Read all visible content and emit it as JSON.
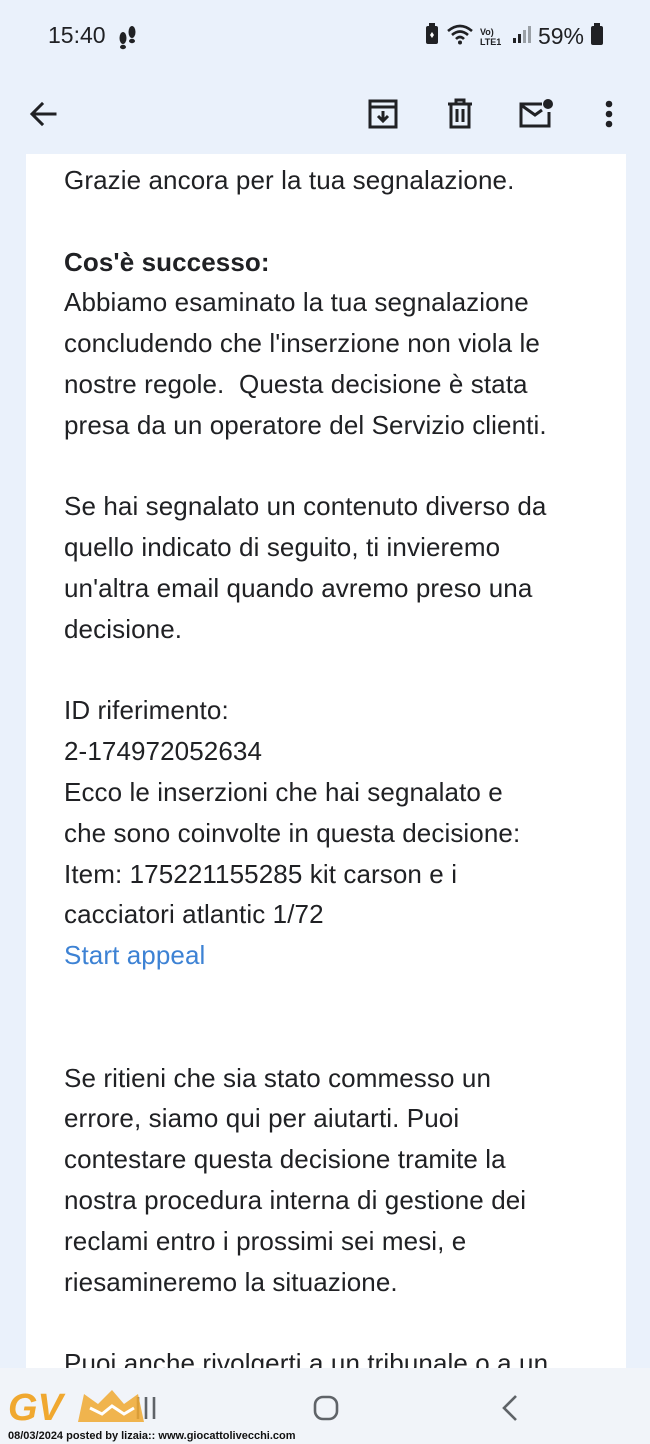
{
  "status_bar": {
    "time": "15:40",
    "network_label": "Vo) LTE1",
    "battery": "59%",
    "icons": [
      "footsteps-icon",
      "battery-saver-icon",
      "wifi-icon",
      "volte-icon",
      "signal-icon",
      "battery-icon"
    ]
  },
  "toolbar": {
    "icons": [
      "back-arrow-icon",
      "archive-icon",
      "delete-icon",
      "mark-unread-icon",
      "more-vert-icon"
    ]
  },
  "email": {
    "thanks": "Grazie ancora per la tua segnalazione.",
    "what_happened_heading": "Cos'è successo:",
    "para1": [
      "Abbiamo esaminato la tua segnalazione",
      "concludendo che l'inserzione non viola le",
      "nostre regole.  Questa decisione è stata",
      "presa da un operatore del Servizio clienti."
    ],
    "para2": [
      "Se hai segnalato un contenuto diverso da",
      "quello indicato di seguito, ti invieremo",
      "un'altra email quando avremo preso una",
      "decisione."
    ],
    "reference_label": "ID riferimento:",
    "reference_id": "2-174972052634",
    "para3": [
      "Ecco le inserzioni che hai segnalato e",
      "che sono coinvolte in questa decisione:",
      "Item: 175221155285 kit carson e i",
      "cacciatori atlantic 1/72"
    ],
    "appeal_link": "Start appeal",
    "para4": [
      "Se ritieni che sia stato commesso un",
      "errore, siamo qui per aiutarti. Puoi",
      "contestare questa decisione tramite la",
      "nostra procedura interna di gestione dei",
      "reclami entro i prossimi sei mesi, e",
      "riesamineremo la situazione."
    ],
    "para5_partial": "Puoi anche rivolgerti a un tribunale o a un"
  },
  "nav_bar": {
    "icons": [
      "recent-apps-icon",
      "home-icon",
      "back-icon"
    ]
  },
  "watermark": {
    "logo_text": "GV",
    "caption": "08/03/2024 posted by lizaia:: www.giocattolivecchi.com",
    "colors": {
      "logo": "#f0a830"
    }
  },
  "colors": {
    "app_background": "#eaf1fb",
    "card_background": "#ffffff",
    "text": "#202124",
    "link": "#3d82d4",
    "nav_background": "#f1f4f9"
  }
}
